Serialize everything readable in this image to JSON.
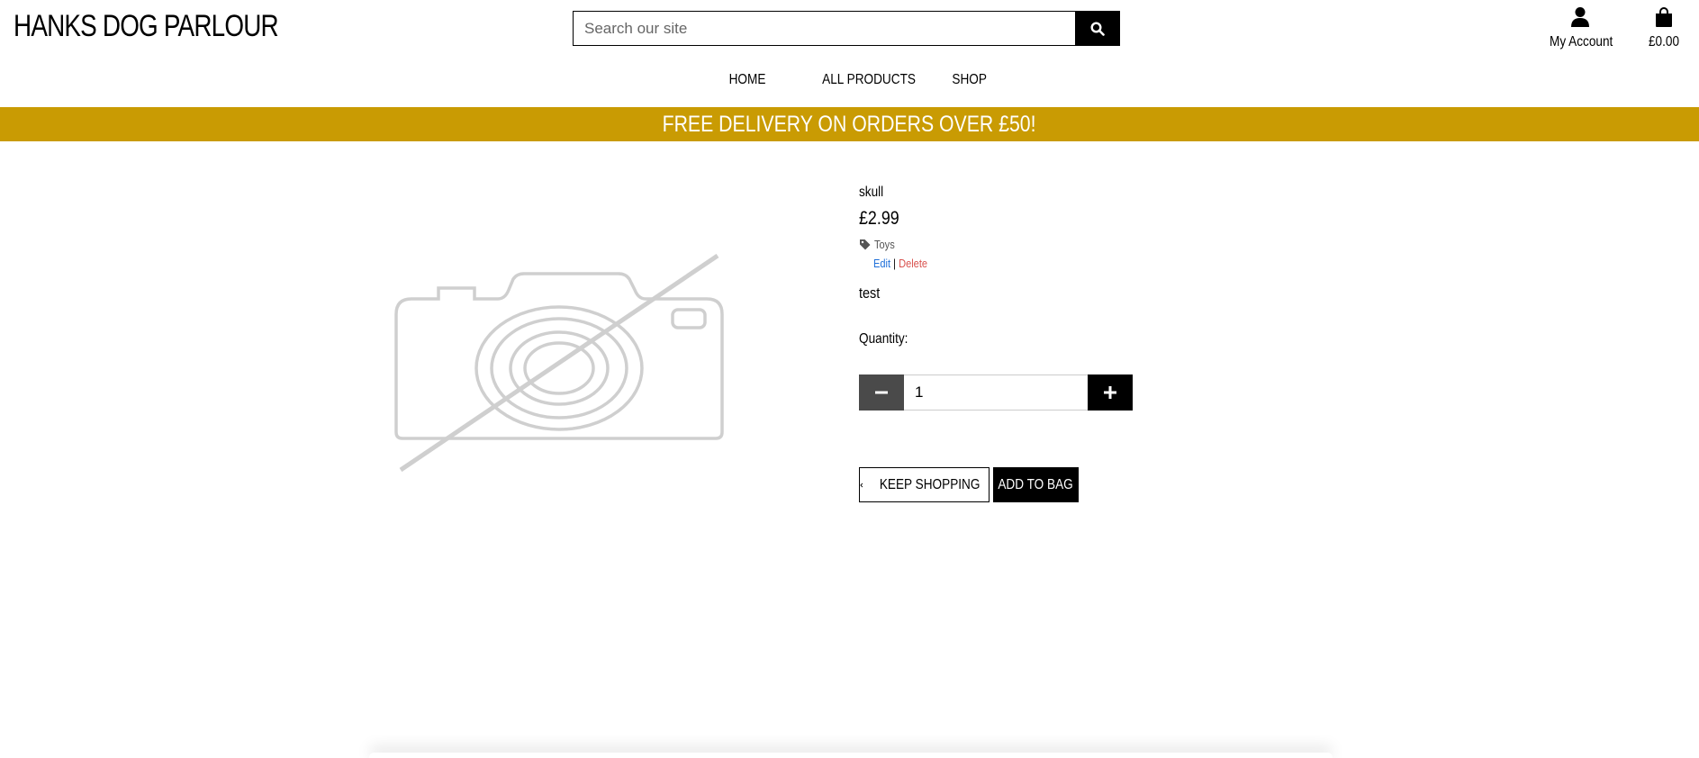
{
  "header": {
    "logo": "HANKS DOG PARLOUR",
    "search_placeholder": "Search our site",
    "search_icon": "search-icon",
    "account_label": "My Account",
    "account_icon": "user-icon",
    "bag_total": "£0.00",
    "bag_icon": "shopping-bag-icon"
  },
  "nav": {
    "items": [
      "HOME",
      "ALL PRODUCTS",
      "SHOP"
    ]
  },
  "banner": {
    "text": "FREE DELIVERY ON ORDERS OVER £50!",
    "color": "#c99b03"
  },
  "product": {
    "image_icon": "no-image-icon",
    "name": "skull",
    "price": "£2.99",
    "category_icon": "tag-icon",
    "category": "Toys",
    "edit_label": "Edit",
    "separator": "|",
    "delete_label": "Delete",
    "description": "test",
    "quantity_label": "Quantity:",
    "quantity_value": "1",
    "minus_icon": "minus-icon",
    "plus_icon": "plus-icon"
  },
  "actions": {
    "keep_shopping": "KEEP SHOPPING",
    "keep_icon": "chevron-left-icon",
    "add_to_bag": "ADD TO BAG"
  },
  "colors": {
    "accent": "#c99b03",
    "edit": "#1e6fd9",
    "delete": "#d9534f"
  }
}
